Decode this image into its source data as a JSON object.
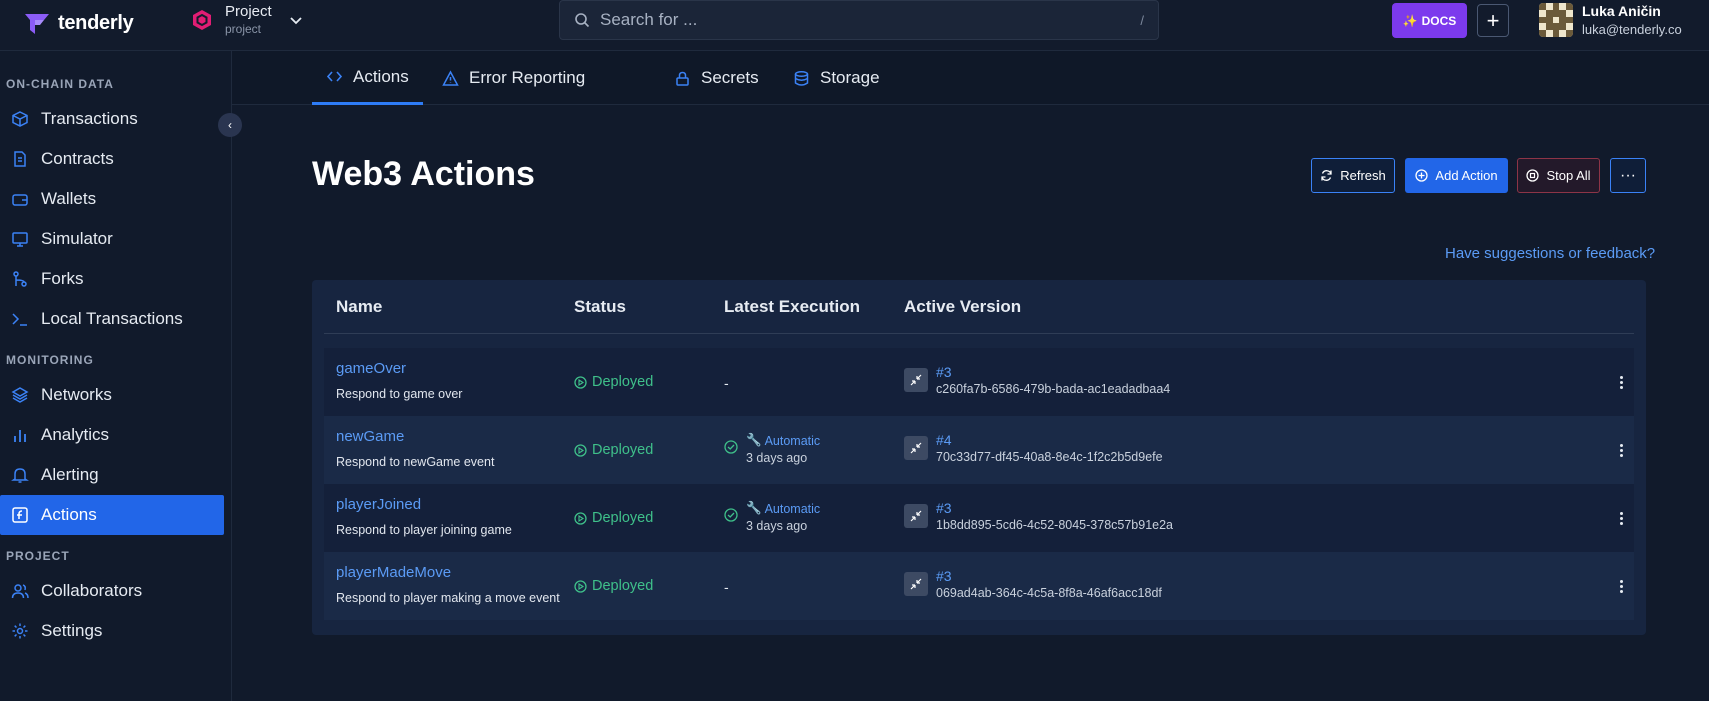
{
  "app": {
    "brand": "tenderly"
  },
  "project": {
    "name": "Project",
    "slug": "project"
  },
  "search": {
    "placeholder": "Search for ...",
    "shortcut": "/"
  },
  "header": {
    "docs_label": "DOCS",
    "add_label": "+"
  },
  "user": {
    "name": "Luka Aničin",
    "email": "luka@tenderly.co"
  },
  "sidebar": {
    "sections": [
      {
        "title": "ON-CHAIN DATA",
        "items": [
          {
            "label": "Transactions",
            "icon": "cube-icon"
          },
          {
            "label": "Contracts",
            "icon": "document-icon"
          },
          {
            "label": "Wallets",
            "icon": "wallet-icon"
          },
          {
            "label": "Simulator",
            "icon": "monitor-icon"
          },
          {
            "label": "Forks",
            "icon": "fork-icon"
          },
          {
            "label": "Local Transactions",
            "icon": "terminal-icon"
          }
        ]
      },
      {
        "title": "MONITORING",
        "items": [
          {
            "label": "Networks",
            "icon": "layers-icon"
          },
          {
            "label": "Analytics",
            "icon": "bar-chart-icon"
          },
          {
            "label": "Alerting",
            "icon": "bell-icon"
          },
          {
            "label": "Actions",
            "icon": "function-icon",
            "active": true
          }
        ]
      },
      {
        "title": "PROJECT",
        "items": [
          {
            "label": "Collaborators",
            "icon": "users-icon"
          },
          {
            "label": "Settings",
            "icon": "gear-icon"
          }
        ]
      }
    ]
  },
  "tabs": [
    {
      "label": "Actions",
      "icon": "code-icon",
      "active": true
    },
    {
      "label": "Error Reporting",
      "icon": "warning-icon"
    },
    {
      "label": "Secrets",
      "icon": "lock-icon"
    },
    {
      "label": "Storage",
      "icon": "database-icon"
    }
  ],
  "main": {
    "title": "Web3 Actions",
    "buttons": {
      "refresh": "Refresh",
      "add": "Add Action",
      "stop": "Stop All",
      "more": "···"
    },
    "feedback_link": "Have suggestions or feedback?"
  },
  "table": {
    "columns": [
      "Name",
      "Status",
      "Latest Execution",
      "Active Version"
    ],
    "rows": [
      {
        "name": "gameOver",
        "description": "Respond to game over",
        "status": "Deployed",
        "execution": null,
        "execution_dash": "-",
        "version": "#3",
        "hash": "c260fa7b-6586-479b-bada-ac1eadadbaa4"
      },
      {
        "name": "newGame",
        "description": "Respond to newGame event",
        "status": "Deployed",
        "execution": {
          "type": "Automatic",
          "time": "3 days ago"
        },
        "version": "#4",
        "hash": "70c33d77-df45-40a8-8e4c-1f2c2b5d9efe"
      },
      {
        "name": "playerJoined",
        "description": "Respond to player joining game",
        "status": "Deployed",
        "execution": {
          "type": "Automatic",
          "time": "3 days ago"
        },
        "version": "#3",
        "hash": "1b8dd895-5cd6-4c52-8045-378c57b91e2a"
      },
      {
        "name": "playerMadeMove",
        "description": "Respond to player making a move event",
        "status": "Deployed",
        "execution": null,
        "execution_dash": "-",
        "version": "#3",
        "hash": "069ad4ab-364c-4c5a-8f8a-46af6acc18df"
      }
    ]
  },
  "colors": {
    "accent": "#2266e8",
    "link": "#5b9bf5",
    "success": "#3fc08a",
    "danger": "#8d3447",
    "docs": "#7c3aed"
  }
}
